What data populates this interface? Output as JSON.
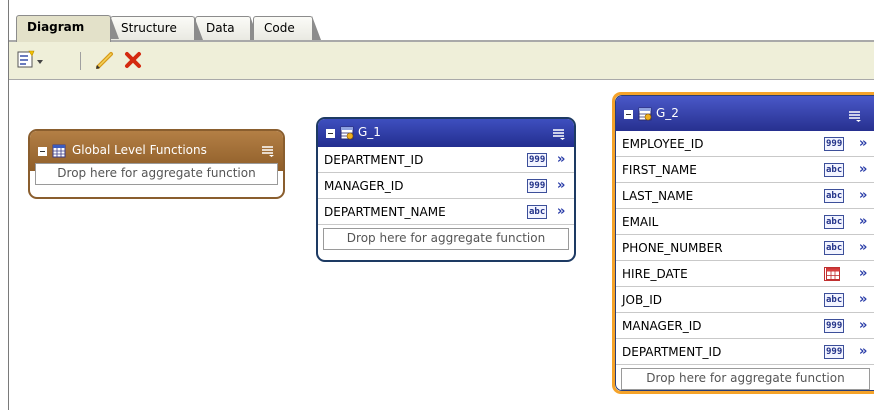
{
  "tabs": [
    {
      "label": "Diagram",
      "active": true
    },
    {
      "label": "Structure",
      "active": false
    },
    {
      "label": "Data",
      "active": false
    },
    {
      "label": "Code",
      "active": false
    }
  ],
  "toolbar": {
    "icons": [
      "new-element-dropdown-icon",
      "pencil-edit-icon",
      "delete-x-icon"
    ]
  },
  "colors": {
    "brown_header": "#9a6a35",
    "blue_header": "#2d3aa6",
    "selection_outline": "#f5a32a",
    "toolbar_bg": "#efefd9"
  },
  "global_card": {
    "title": "Global Level Functions",
    "drop_text": "Drop here for aggregate function"
  },
  "g1": {
    "title": "G_1",
    "fields": [
      {
        "name": "DEPARTMENT_ID",
        "type": "999"
      },
      {
        "name": "MANAGER_ID",
        "type": "999"
      },
      {
        "name": "DEPARTMENT_NAME",
        "type": "abc"
      }
    ],
    "drop_text": "Drop here for aggregate function"
  },
  "g2": {
    "title": "G_2",
    "fields": [
      {
        "name": "EMPLOYEE_ID",
        "type": "999"
      },
      {
        "name": "FIRST_NAME",
        "type": "abc"
      },
      {
        "name": "LAST_NAME",
        "type": "abc"
      },
      {
        "name": "EMAIL",
        "type": "abc"
      },
      {
        "name": "PHONE_NUMBER",
        "type": "abc"
      },
      {
        "name": "HIRE_DATE",
        "type": "date"
      },
      {
        "name": "JOB_ID",
        "type": "abc"
      },
      {
        "name": "MANAGER_ID",
        "type": "999"
      },
      {
        "name": "DEPARTMENT_ID",
        "type": "999"
      }
    ],
    "drop_text": "Drop here for aggregate function"
  },
  "arrow_glyph": "»"
}
